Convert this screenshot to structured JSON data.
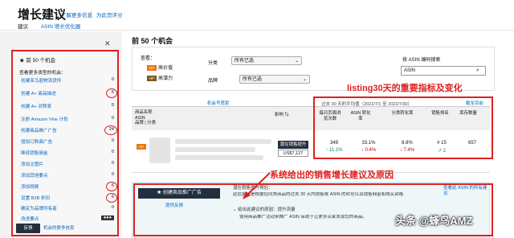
{
  "header": {
    "title": "增长建议",
    "link1": "了解更多信息",
    "link2": "为此页评分",
    "tabs": [
      "建议",
      "ASIN 增长优化器"
    ]
  },
  "sidebar": {
    "head": "前 50 个机会",
    "subtitle": "查看更多类型的机会：",
    "items": [
      {
        "label": "创建亚马逊物流货件",
        "count": "0"
      },
      {
        "label": "创建 A+ 商品描述",
        "count": "6"
      },
      {
        "label": "创建 A+ 对照表",
        "count": "0"
      },
      {
        "label": "注册 Amazon Vine 计划",
        "count": "0"
      },
      {
        "label": "创建商品推广广告",
        "count": "24"
      },
      {
        "label": "增加订购商广告",
        "count": "0"
      },
      {
        "label": "降低销售佣金",
        "count": "0"
      },
      {
        "label": "添加主图片",
        "count": "0"
      },
      {
        "label": "添加其他要点",
        "count": "0"
      },
      {
        "label": "添加视频",
        "count": "6"
      },
      {
        "label": "设置 B2B 折扣",
        "count": "6"
      },
      {
        "label": "确定为品牌所有者",
        "count": "0"
      },
      {
        "label": "改进要点",
        "count": ""
      }
    ],
    "footer_btn": "反馈",
    "footer_link": "机会的更多信息"
  },
  "main": {
    "title": "前 50 个机会",
    "filters": {
      "view_label": "查看：",
      "option1": "高价值",
      "option2": "高潜力",
      "category_label": "分类",
      "category_value": "所有已选",
      "brand_label": "品牌",
      "brand_value": "所有已选",
      "asin_label": "按 ASIN 编码搜索",
      "asin_placeholder": "ASIN"
    },
    "table_note": "机会号差距",
    "period": "过去 30 天的平均值（2022/7/1 至 2022/7/30）",
    "headers": {
      "product": "商品名称",
      "asin": "ASIN",
      "brand": "品牌 | 分类",
      "impact": "影响",
      "daily_views": "每日页面浏览次数",
      "asin_cvr": "ASIN 转化率",
      "category_cvr": "分类转化率",
      "rank": "销售排名",
      "inventory": "库存数量"
    },
    "row": {
      "impact_label": "潜在销售提升",
      "impact_value": "US$7,127",
      "views": "349",
      "views_change": "↑ 11.1%",
      "asin_cvr": "33.1%",
      "asin_cvr_change": "↓ 0.4%",
      "cat_cvr": "8.8%",
      "cat_cvr_change": "↓ 7.4%",
      "rank": "# 15",
      "rank_change": "↗ 2",
      "inventory": "657"
    },
    "rec": {
      "button": "创建商品推广广告",
      "feedback": "提供反馈",
      "why_title": "潜在销售提升预估：",
      "why_text": "此估算值是根据您同类商品的过去 30 天内销售或 ASIN 的转化以及销售佣金和购买资格",
      "detail_title": "给出此建议的原因：提升流量",
      "detail_text": "使用商品推广活动来推广 ASIN 有助于让更多买家发现您的商品。",
      "related": "查看此 ASIN 的所有建议"
    }
  },
  "annotations": {
    "metrics": "listing30天的重要指标及变化",
    "suggestion": "系统给出的销售增长建议及原因"
  },
  "watermark": "头条 @蜂鸟AMZ"
}
